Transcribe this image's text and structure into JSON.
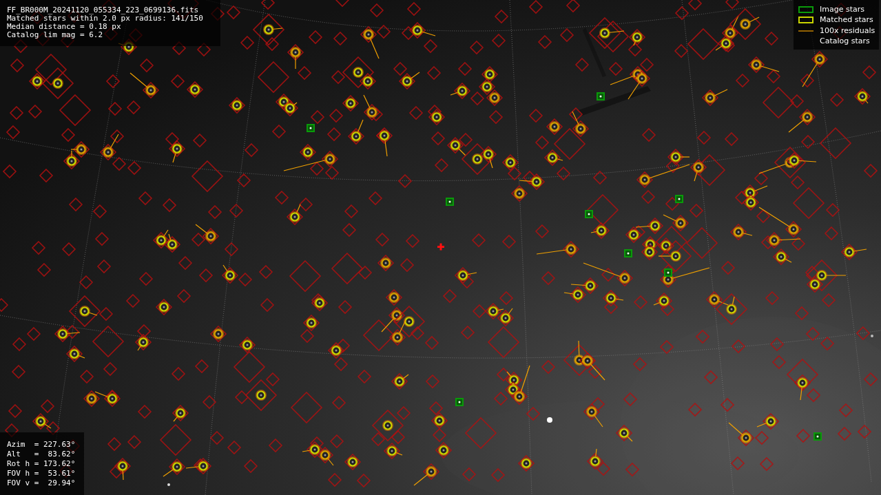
{
  "file_info": {
    "lines": [
      "FF_BR000M_20241120_055334_223_0699136.fits",
      "Matched stars within 2.0 px radius: 141/150",
      "Median distance = 0.18 px",
      "Catalog lim mag = 6.2"
    ]
  },
  "legend": [
    {
      "label": "Image stars"
    },
    {
      "kind": "matched",
      "label": "Matched stars"
    },
    {
      "kind": "residual",
      "label": "100x residuals"
    },
    {
      "kind": "catalog",
      "label": "Catalog stars"
    }
  ],
  "pointing": {
    "lines": [
      "Azim  = 227.63°",
      "Alt   =  83.62°",
      "Rot h = 173.62°",
      "FOV h =  53.61°",
      "FOV v =  29.94°"
    ]
  }
}
